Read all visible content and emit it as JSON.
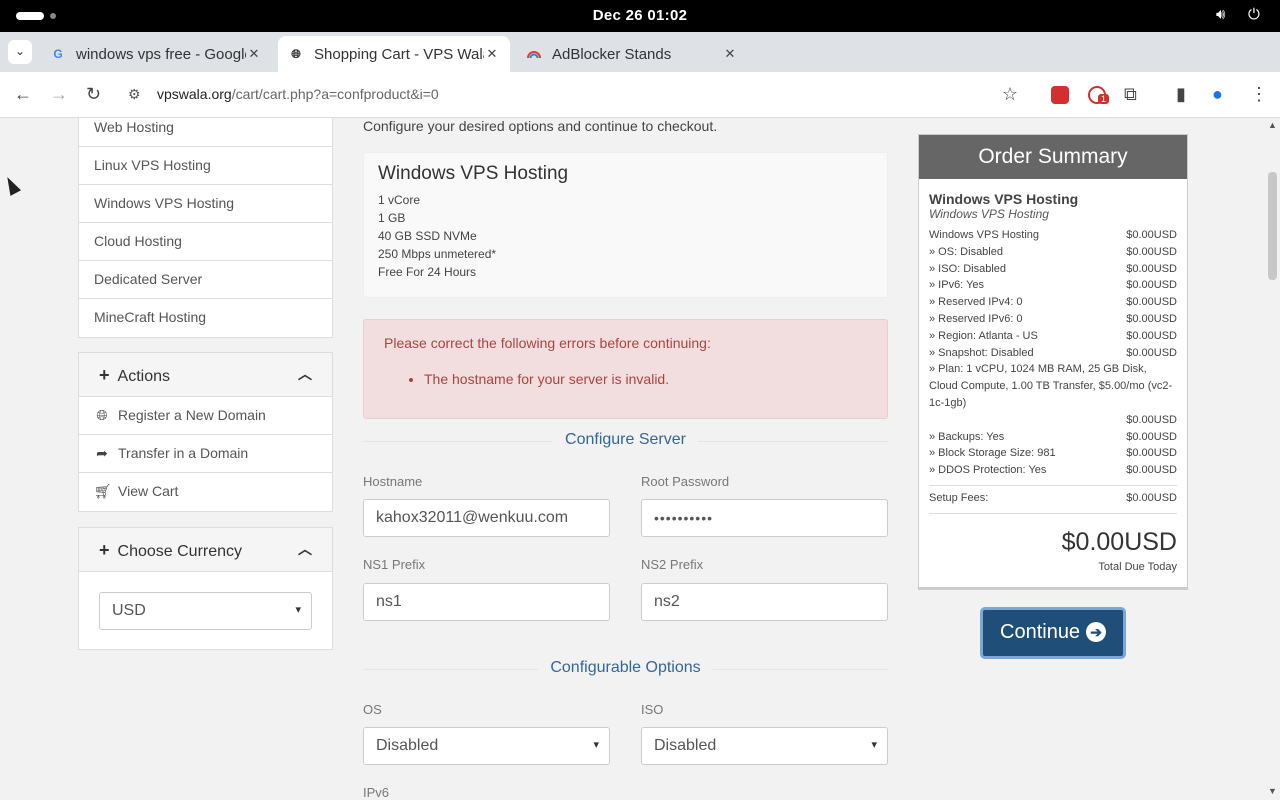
{
  "system": {
    "clock": "Dec 26  01:02"
  },
  "browser": {
    "tabs": [
      {
        "title": "windows vps free - Google",
        "favicon": "google-icon"
      },
      {
        "title": "Shopping Cart - VPS Wala",
        "favicon": "globe-icon"
      },
      {
        "title": "AdBlocker Stands",
        "favicon": "rainbow-icon"
      }
    ],
    "url_domain": "vpswala.org",
    "url_path": "/cart/cart.php?a=confproduct&i=0",
    "extension_badge": "1"
  },
  "sidebar": {
    "categories": [
      "Web Hosting",
      "Linux VPS Hosting",
      "Windows VPS Hosting",
      "Cloud Hosting",
      "Dedicated Server",
      "MineCraft Hosting"
    ],
    "actions_title": "Actions",
    "actions": [
      {
        "label": "Register a New Domain",
        "icon": "globe-icon"
      },
      {
        "label": "Transfer in a Domain",
        "icon": "share-icon"
      },
      {
        "label": "View Cart",
        "icon": "cart-icon"
      }
    ],
    "currency_title": "Choose Currency",
    "currency_value": "USD"
  },
  "main": {
    "intro": "Configure your desired options and continue to checkout.",
    "product": {
      "name": "Windows VPS Hosting",
      "specs": [
        "1 vCore",
        "1 GB",
        "40 GB SSD NVMe",
        "250 Mbps unmetered*",
        "Free For 24 Hours"
      ]
    },
    "error": {
      "heading": "Please correct the following errors before continuing:",
      "items": [
        "The hostname for your server is invalid."
      ]
    },
    "configure_server_title": "Configure Server",
    "fields": {
      "hostname_label": "Hostname",
      "hostname_value": "kahox32011@wenkuu.com",
      "root_password_label": "Root Password",
      "root_password_value": "••••••••••",
      "ns1_label": "NS1 Prefix",
      "ns1_value": "ns1",
      "ns2_label": "NS2 Prefix",
      "ns2_value": "ns2"
    },
    "configurable_options_title": "Configurable Options",
    "options": {
      "os_label": "OS",
      "os_value": "Disabled",
      "iso_label": "ISO",
      "iso_value": "Disabled",
      "ipv6_label": "IPv6"
    }
  },
  "summary": {
    "title": "Order Summary",
    "product_name": "Windows VPS Hosting",
    "product_group": "Windows VPS Hosting",
    "lines": [
      {
        "label": "Windows VPS Hosting",
        "amount": "$0.00USD"
      },
      {
        "label": " » OS: Disabled",
        "amount": "$0.00USD"
      },
      {
        "label": " » ISO: Disabled",
        "amount": "$0.00USD"
      },
      {
        "label": " » IPv6: Yes",
        "amount": "$0.00USD"
      },
      {
        "label": " » Reserved IPv4: 0",
        "amount": "$0.00USD"
      },
      {
        "label": " » Reserved IPv6: 0",
        "amount": "$0.00USD"
      },
      {
        "label": " » Region: Atlanta - US",
        "amount": "$0.00USD"
      },
      {
        "label": " » Snapshot: Disabled",
        "amount": "$0.00USD"
      }
    ],
    "plan_line": " » Plan: 1 vCPU, 1024 MB RAM, 25 GB Disk, Cloud Compute, 1.00 TB Transfer, $5.00/mo (vc2-1c-1gb)",
    "plan_amount": "$0.00USD",
    "lines2": [
      {
        "label": " » Backups: Yes",
        "amount": "$0.00USD"
      },
      {
        "label": " » Block Storage Size: 981",
        "amount": "$0.00USD"
      },
      {
        "label": " » DDOS Protection: Yes",
        "amount": "$0.00USD"
      }
    ],
    "setup_label": "Setup Fees:",
    "setup_amount": "$0.00USD",
    "total": "$0.00USD",
    "total_label": "Total Due Today",
    "continue_label": "Continue"
  }
}
